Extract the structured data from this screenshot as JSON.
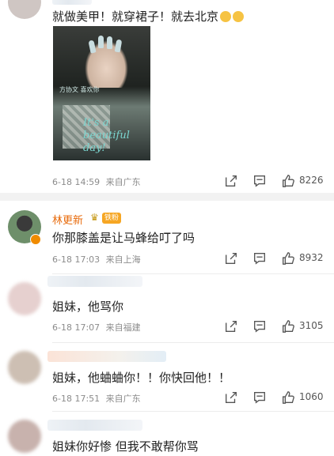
{
  "comments": [
    {
      "author": "",
      "text": "就做美甲！就穿裙子！就去北京",
      "date": "6-18 14:59",
      "location": "来自广东",
      "likes": "8226",
      "photo_handwriting": "It's a beautiful day!",
      "photo_caption": "方协文 喜欢你"
    },
    {
      "author": "林更新",
      "badge": "铁粉",
      "text": "你那膝盖是让马蜂给叮了吗",
      "date": "6-18 17:03",
      "location": "来自上海",
      "likes": "8932"
    },
    {
      "author": "",
      "text": "姐妹，他骂你",
      "date": "6-18 17:07",
      "location": "来自福建",
      "likes": "3105"
    },
    {
      "author": "",
      "text": "姐妹，他蛐蛐你！！你快回他！！",
      "date": "6-18 17:51",
      "location": "来自广东",
      "likes": "1060"
    },
    {
      "author": "",
      "text": "姐妹你好惨 但我不敢帮你骂"
    }
  ],
  "icons": {
    "share": "share-icon",
    "comment": "comment-icon",
    "like": "thumbs-up-icon"
  },
  "colors": {
    "author": "#e86b0c",
    "meta": "#8c8c8c",
    "divider": "#f2f2f2"
  }
}
